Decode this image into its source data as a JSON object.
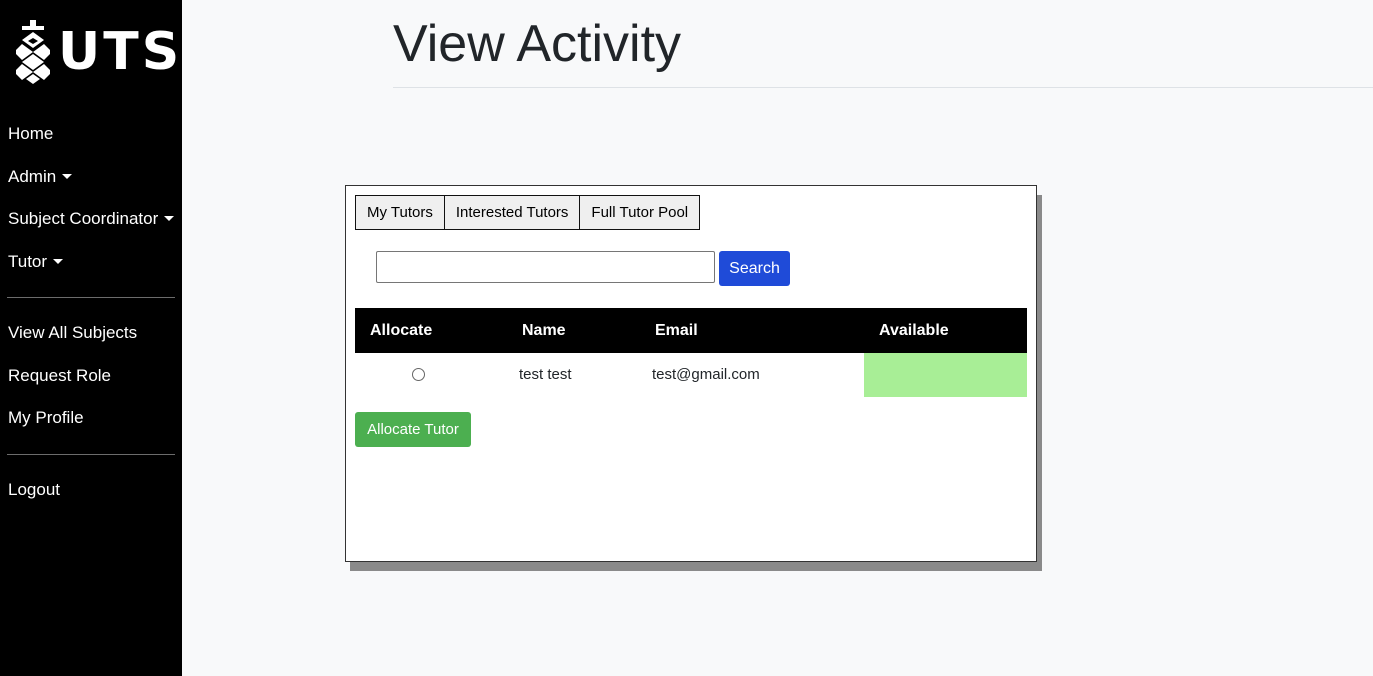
{
  "brand": {
    "logo_text": "UTS",
    "emblem_icon": "uts-emblem-icon"
  },
  "sidebar": {
    "items": [
      {
        "label": "Home"
      },
      {
        "label": "Admin",
        "dropdown": true
      },
      {
        "label": "Subject Coordinator",
        "dropdown": true
      },
      {
        "label": "Tutor",
        "dropdown": true
      },
      {
        "label": "View All Subjects"
      },
      {
        "label": "Request Role"
      },
      {
        "label": "My Profile"
      },
      {
        "label": "Logout"
      }
    ]
  },
  "page": {
    "title": "View Activity"
  },
  "tabs": [
    {
      "label": "My Tutors"
    },
    {
      "label": "Interested Tutors"
    },
    {
      "label": "Full Tutor Pool"
    }
  ],
  "search": {
    "value": "",
    "placeholder": "",
    "button_label": "Search"
  },
  "table": {
    "headers": [
      "Allocate",
      "Name",
      "Email",
      "Available"
    ],
    "rows": [
      {
        "name": "test test",
        "email": "test@gmail.com",
        "selected": false,
        "available_color": "#a8ee96"
      }
    ]
  },
  "actions": {
    "allocate_label": "Allocate Tutor"
  },
  "colors": {
    "sidebar_bg": "#000000",
    "primary": "#1f4bd8",
    "success": "#4caf50",
    "available": "#a8ee96"
  }
}
